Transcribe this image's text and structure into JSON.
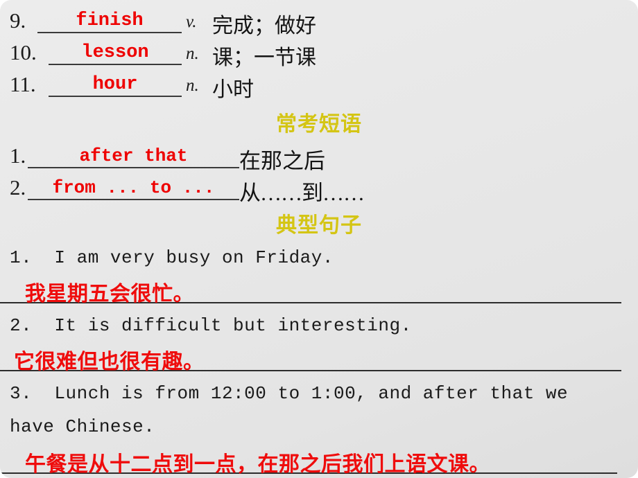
{
  "slide": {
    "background_color": "#e8e8e8",
    "accent_heading_color": "#d4c514",
    "answer_color": "#ee0000"
  },
  "vocabulary": {
    "items": [
      {
        "number": "9.",
        "answer": "finish",
        "pos": "v.",
        "meaning": "完成；做好"
      },
      {
        "number": "10.",
        "answer": "lesson",
        "pos": "n.",
        "meaning": "课；一节课"
      },
      {
        "number": "11.",
        "answer": "hour",
        "pos": "n.",
        "meaning": "小时"
      }
    ]
  },
  "phrases": {
    "heading": "常考短语",
    "items": [
      {
        "number": "1.",
        "answer": "after that",
        "meaning": "在那之后"
      },
      {
        "number": "2.",
        "answer": "from ... to ...",
        "meaning": "从……到……"
      }
    ]
  },
  "sentences": {
    "heading": "典型句子",
    "items": [
      {
        "number": "1.",
        "english": "1.  I am very busy on Friday.",
        "chinese": "我星期五会很忙。"
      },
      {
        "number": "2.",
        "english": "2.  It is difficult but interesting.",
        "chinese": "它很难但也很有趣。"
      },
      {
        "number": "3.",
        "english_line1": "3.  Lunch is from 12:00 to 1:00, and after that we",
        "english_line2": "have Chinese.",
        "chinese": "午餐是从十二点到一点，在那之后我们上语文课。"
      }
    ]
  }
}
